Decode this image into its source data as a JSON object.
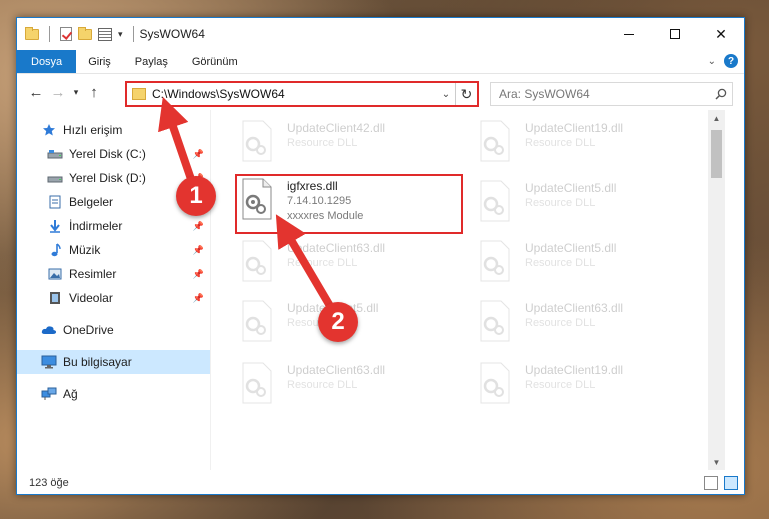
{
  "window": {
    "title": "SysWOW64"
  },
  "ribbon": {
    "tabs": [
      "Dosya",
      "Giriş",
      "Paylaş",
      "Görünüm"
    ]
  },
  "address": {
    "path": "C:\\Windows\\SysWOW64"
  },
  "search": {
    "placeholder": "Ara: SysWOW64"
  },
  "sidebar": {
    "items": [
      {
        "label": "Hızlı erişim",
        "icon": "star-icon",
        "pinned": false
      },
      {
        "label": "Yerel Disk (C:)",
        "icon": "drive-icon",
        "pinned": true
      },
      {
        "label": "Yerel Disk (D:)",
        "icon": "drive-icon",
        "pinned": true
      },
      {
        "label": "Belgeler",
        "icon": "document-icon",
        "pinned": false
      },
      {
        "label": "İndirmeler",
        "icon": "download-icon",
        "pinned": true
      },
      {
        "label": "Müzik",
        "icon": "music-icon",
        "pinned": true
      },
      {
        "label": "Resimler",
        "icon": "pictures-icon",
        "pinned": true
      },
      {
        "label": "Videolar",
        "icon": "video-icon",
        "pinned": true
      },
      {
        "label": "OneDrive",
        "icon": "cloud-icon",
        "pinned": false
      },
      {
        "label": "Bu bilgisayar",
        "icon": "computer-icon",
        "pinned": false,
        "selected": true
      },
      {
        "label": "Ağ",
        "icon": "network-icon",
        "pinned": false
      }
    ]
  },
  "files": {
    "highlighted": {
      "name": "igfxres.dll",
      "version": "7.14.10.1295",
      "description": "xxxxres Module"
    },
    "left_column": [
      {
        "name": "UpdateClient42.dll",
        "description": "Resource DLL"
      },
      {
        "name": "UpdateClient63.dll",
        "description": "Resource DLL"
      },
      {
        "name": "UpdateClient5.dll",
        "description": "Resource DLL"
      },
      {
        "name": "UpdateClient63.dll",
        "description": "Resource DLL"
      }
    ],
    "right_column": [
      {
        "name": "UpdateClient19.dll",
        "description": "Resource DLL"
      },
      {
        "name": "UpdateClient5.dll",
        "description": "Resource DLL"
      },
      {
        "name": "UpdateClient5.dll",
        "description": "Resource DLL"
      },
      {
        "name": "UpdateClient63.dll",
        "description": "Resource DLL"
      },
      {
        "name": "UpdateClient19.dll",
        "description": "Resource DLL"
      }
    ]
  },
  "status": {
    "count": "123 öğe"
  },
  "annotations": {
    "step1": "1",
    "step2": "2",
    "color": "#e3342f"
  },
  "colors": {
    "accent": "#1979ca",
    "highlight": "#e02a2a",
    "selected_bg": "#cce8ff"
  }
}
